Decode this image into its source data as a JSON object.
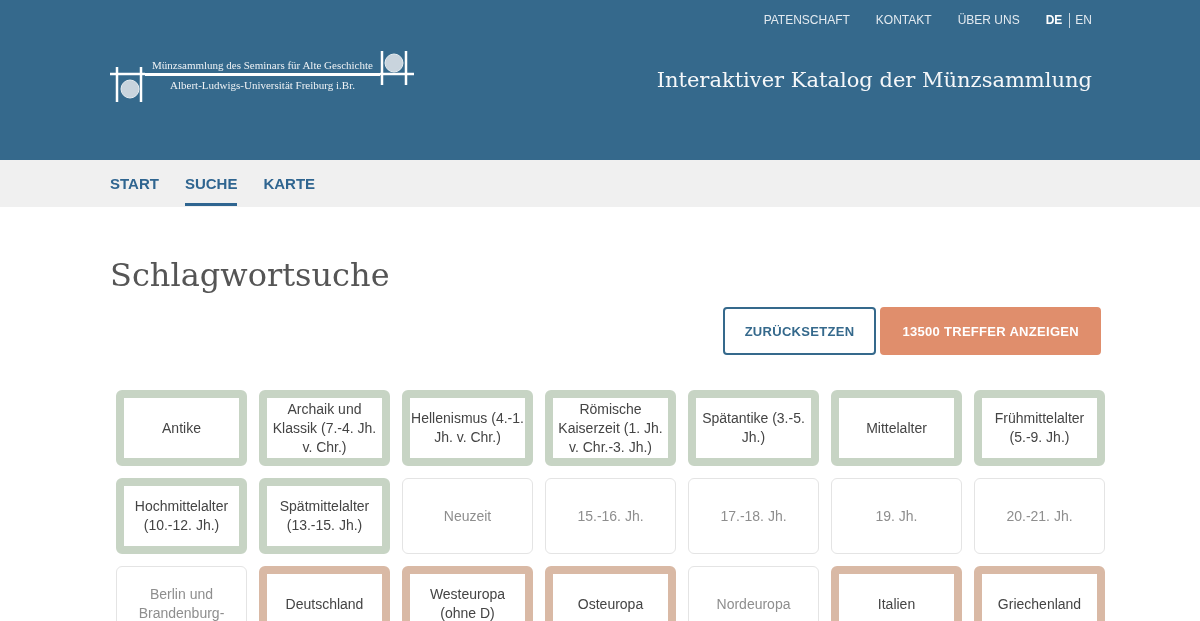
{
  "top_links": [
    "PATENSCHAFT",
    "KONTAKT",
    "ÜBER UNS"
  ],
  "languages": [
    {
      "label": "DE",
      "selected": true
    },
    {
      "label": "EN",
      "selected": false
    }
  ],
  "logo": {
    "line_1": "Münzsammlung des Seminars für Alte Geschichte",
    "line_2": "Albert-Ludwigs-Universität Freiburg i.Br."
  },
  "site_title": "Interaktiver Katalog der Münzsammlung",
  "nav": [
    {
      "label": "START",
      "selected": false
    },
    {
      "label": "SUCHE",
      "selected": true
    },
    {
      "label": "KARTE",
      "selected": false
    }
  ],
  "page_title": "Schlagwortsuche",
  "buttons": [
    {
      "label": "ZURÜCKSETZEN",
      "kind": "outline"
    },
    {
      "label": "13500 TREFFER ANZEIGEN",
      "kind": "primary"
    }
  ],
  "tiles": [
    {
      "label": "Antike",
      "disabled": false,
      "color": "#c7d4c4"
    },
    {
      "label": "Archaik und Klassik (7.-4. Jh. v. Chr.)",
      "disabled": false,
      "color": "#c7d4c4"
    },
    {
      "label": "Hellenismus (4.-1. Jh. v. Chr.)",
      "disabled": false,
      "color": "#c7d4c4"
    },
    {
      "label": "Römische Kaiserzeit (1. Jh. v. Chr.-3. Jh.)",
      "disabled": false,
      "color": "#c7d4c4"
    },
    {
      "label": "Spätantike (3.-5. Jh.)",
      "disabled": false,
      "color": "#c7d4c4"
    },
    {
      "label": "Mittelalter",
      "disabled": false,
      "color": "#c7d4c4"
    },
    {
      "label": "Frühmittelalter (5.-9. Jh.)",
      "disabled": false,
      "color": "#c7d4c4"
    },
    {
      "label": "Hochmittelalter (10.-12. Jh.)",
      "disabled": false,
      "color": "#c7d4c4"
    },
    {
      "label": "Spätmittelalter (13.-15. Jh.)",
      "disabled": false,
      "color": "#c7d4c4"
    },
    {
      "label": "Neuzeit",
      "disabled": true
    },
    {
      "label": "15.-16. Jh.",
      "disabled": true
    },
    {
      "label": "17.-18. Jh.",
      "disabled": true
    },
    {
      "label": "19. Jh.",
      "disabled": true
    },
    {
      "label": "20.-21. Jh.",
      "disabled": true
    },
    {
      "label": "Berlin und Brandenburg-",
      "disabled": true
    },
    {
      "label": "Deutschland",
      "disabled": false,
      "color": "#d9b9a5"
    },
    {
      "label": "Westeuropa (ohne D)",
      "disabled": false,
      "color": "#d9b9a5"
    },
    {
      "label": "Osteuropa",
      "disabled": false,
      "color": "#d9b9a5"
    },
    {
      "label": "Nordeuropa",
      "disabled": true
    },
    {
      "label": "Italien",
      "disabled": false,
      "color": "#d9b9a5"
    },
    {
      "label": "Griechenland",
      "disabled": false,
      "color": "#d9b9a5"
    }
  ]
}
